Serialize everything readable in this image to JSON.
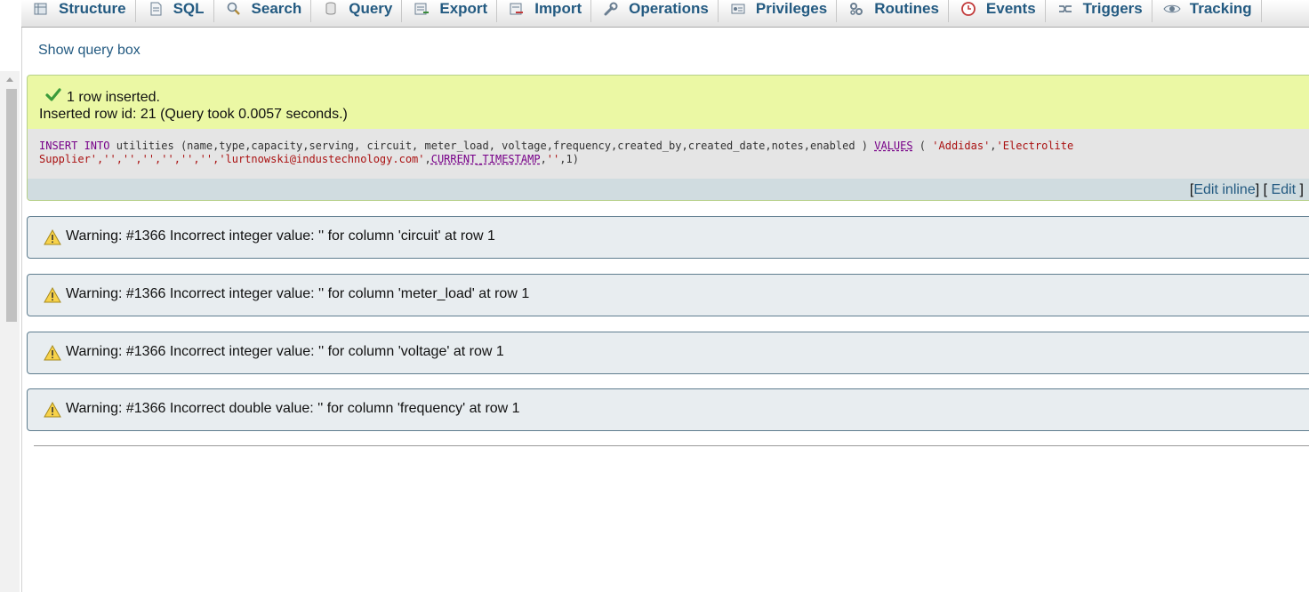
{
  "tabs": [
    {
      "label": "Structure",
      "icon": "structure-icon"
    },
    {
      "label": "SQL",
      "icon": "sql-icon"
    },
    {
      "label": "Search",
      "icon": "search-icon"
    },
    {
      "label": "Query",
      "icon": "query-icon"
    },
    {
      "label": "Export",
      "icon": "export-icon"
    },
    {
      "label": "Import",
      "icon": "import-icon"
    },
    {
      "label": "Operations",
      "icon": "wrench-icon"
    },
    {
      "label": "Privileges",
      "icon": "privileges-icon"
    },
    {
      "label": "Routines",
      "icon": "routines-icon"
    },
    {
      "label": "Events",
      "icon": "clock-icon"
    },
    {
      "label": "Triggers",
      "icon": "triggers-icon"
    },
    {
      "label": "Tracking",
      "icon": "eye-icon"
    }
  ],
  "show_query_link": "Show query box",
  "success": {
    "line1": "1 row inserted.",
    "line2": "Inserted row id: 21 (Query took 0.0057 seconds.)",
    "sql": {
      "kw_insert": "INSERT INTO",
      "table_part": " utilities (name,type,capacity,serving, circuit, meter_load, voltage,frequency,created_by,created_date,notes,enabled ) ",
      "kw_values": "VALUES",
      "open_paren": " ( ",
      "str_addidas": "'Addidas'",
      "comma1": ",",
      "str_electrolite": "'Electrolite Supplier'",
      "empties": ",'','','','','','',",
      "str_email": "'lurtnowski@industechnology.com'",
      "comma2": ",",
      "fn_ts": "CURRENT_TIMESTAMP",
      "comma3": ",",
      "str_empty": "''",
      "tail": ",1)"
    },
    "edit_inline_open": "[",
    "edit_inline": "Edit inline",
    "edit_mid": "] [",
    "edit": "Edit",
    "edit_close": "]"
  },
  "warnings": [
    "Warning: #1366 Incorrect integer value: '' for column 'circuit' at row 1",
    "Warning: #1366 Incorrect integer value: '' for column 'meter_load' at row 1",
    "Warning: #1366 Incorrect integer value: '' for column 'voltage' at row 1",
    "Warning: #1366 Incorrect double value: '' for column 'frequency' at row 1"
  ],
  "colors": {
    "link": "#235a81",
    "success_bg": "#ebf8a4",
    "warning_bg": "#e8edf0",
    "sql_keyword": "#770088",
    "sql_string": "#aa1111"
  }
}
